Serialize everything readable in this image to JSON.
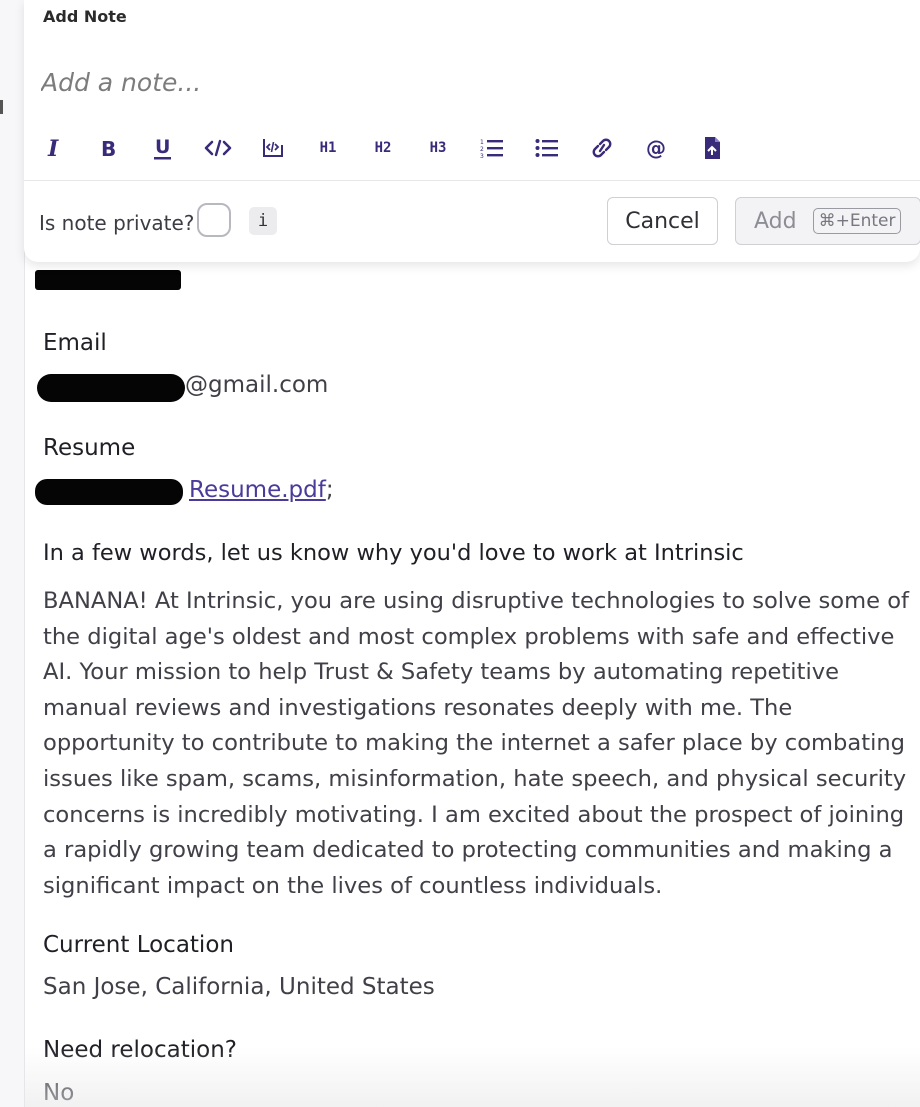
{
  "note": {
    "title": "Add Note",
    "placeholder": "Add a note...",
    "toolbar": {
      "h1": "H1",
      "h2": "H2",
      "h3": "H3"
    },
    "private_label": "Is note private?",
    "info": "i",
    "cancel": "Cancel",
    "add": "Add",
    "shortcut": "⌘+Enter"
  },
  "fields": {
    "name_partial": "",
    "email_label": "Email",
    "email_value": "@gmail.com",
    "resume_label": "Resume",
    "resume_link": "Resume.pdf",
    "resume_sep": ";",
    "why_label": "In a few words, let us know why you'd love to work at Intrinsic",
    "why_value": "BANANA! At Intrinsic, you are using disruptive technologies to solve some of the digital age's oldest and most complex problems with safe and effective AI. Your mission to help Trust & Safety teams by automating repetitive manual reviews and investigations resonates deeply with me. The opportunity to contribute to making the internet a safer place by combating issues like spam, scams, misinformation, hate speech, and physical security concerns is incredibly motivating. I am excited about the prospect of joining a rapidly growing team dedicated to protecting communities and making a significant impact on the lives of countless individuals.",
    "location_label": "Current Location",
    "location_value": "San Jose, California, United States",
    "relocation_label": "Need relocation?",
    "relocation_value": "No"
  },
  "colors": {
    "accent": "#3a2a7a",
    "link": "#4a3a9a"
  }
}
